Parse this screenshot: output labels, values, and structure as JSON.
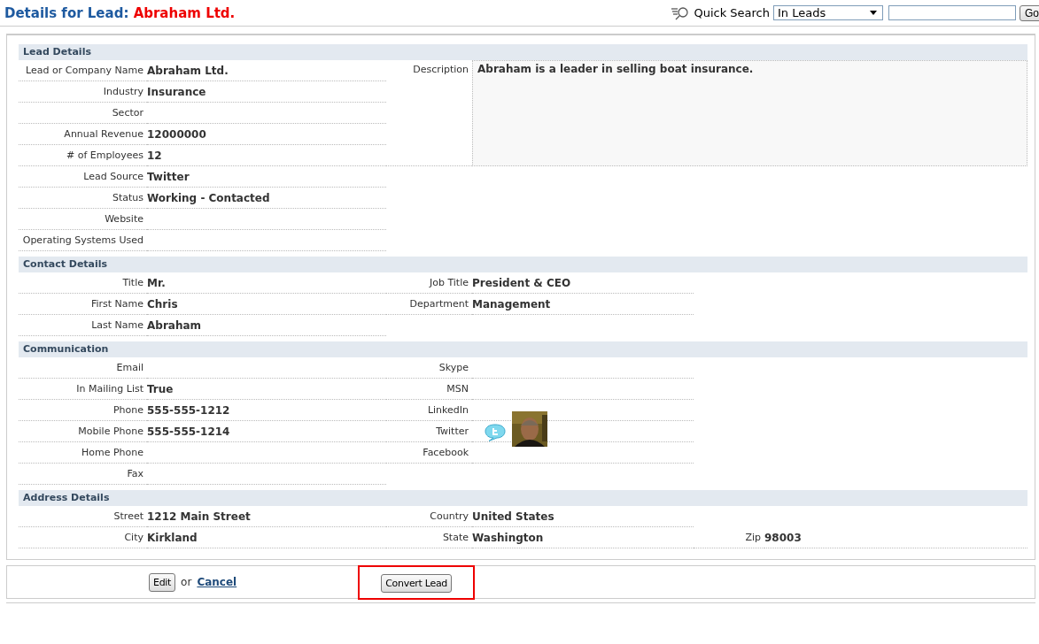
{
  "header": {
    "title": "Details for Lead:",
    "name": "Abraham Ltd."
  },
  "quick_search": {
    "label": "Quick Search",
    "scope": "In Leads",
    "button": "Go"
  },
  "sections": [
    {
      "title": "Lead Details",
      "description": {
        "label": "Description",
        "value": "Abraham is a leader in selling boat insurance."
      },
      "rows": [
        [
          {
            "label": "Lead or Company Name",
            "value": "Abraham Ltd."
          }
        ],
        [
          {
            "label": "Industry",
            "value": "Insurance"
          }
        ],
        [
          {
            "label": "Sector"
          }
        ],
        [
          {
            "label": "Annual Revenue",
            "value": "12000000"
          }
        ],
        [
          {
            "label": "# of Employees",
            "value": "12"
          }
        ],
        [
          {
            "label": "Lead Source",
            "value": "Twitter"
          }
        ],
        [
          {
            "label": "Status",
            "value": "Working - Contacted"
          }
        ],
        [
          {
            "label": "Website"
          }
        ],
        [
          {
            "label": "Operating Systems Used"
          }
        ]
      ]
    },
    {
      "title": "Contact Details",
      "rows": [
        [
          {
            "label": "Title",
            "value": "Mr."
          },
          {
            "label": "Job Title",
            "value": "President & CEO"
          }
        ],
        [
          {
            "label": "First Name",
            "value": "Chris"
          },
          {
            "label": "Department",
            "value": "Management"
          }
        ],
        [
          {
            "label": "Last Name",
            "value": "Abraham"
          }
        ]
      ]
    },
    {
      "title": "Communication",
      "rows": [
        [
          {
            "label": "Email"
          },
          {
            "label": "Skype"
          }
        ],
        [
          {
            "label": "In Mailing List",
            "value": "True"
          },
          {
            "label": "MSN"
          }
        ],
        [
          {
            "label": "Phone",
            "value": "555-555-1212"
          },
          {
            "label": "LinkedIn"
          }
        ],
        [
          {
            "label": "Mobile Phone",
            "value": "555-555-1214"
          },
          {
            "label": "Twitter",
            "kind": "social"
          }
        ],
        [
          {
            "label": "Home Phone"
          },
          {
            "label": "Facebook"
          }
        ],
        [
          {
            "label": "Fax"
          }
        ]
      ]
    },
    {
      "title": "Address Details",
      "rows": [
        [
          {
            "label": "Street",
            "value": "1212 Main Street"
          },
          {
            "label": "Country",
            "value": "United States"
          }
        ],
        [
          {
            "label": "City",
            "value": "Kirkland"
          },
          {
            "label": "State",
            "value": "Washington"
          },
          {
            "label": "Zip",
            "value": "98003"
          }
        ]
      ]
    }
  ],
  "actions": {
    "edit": "Edit",
    "or": "or",
    "cancel": "Cancel",
    "convert": "Convert Lead",
    "convert_highlighted": true
  }
}
